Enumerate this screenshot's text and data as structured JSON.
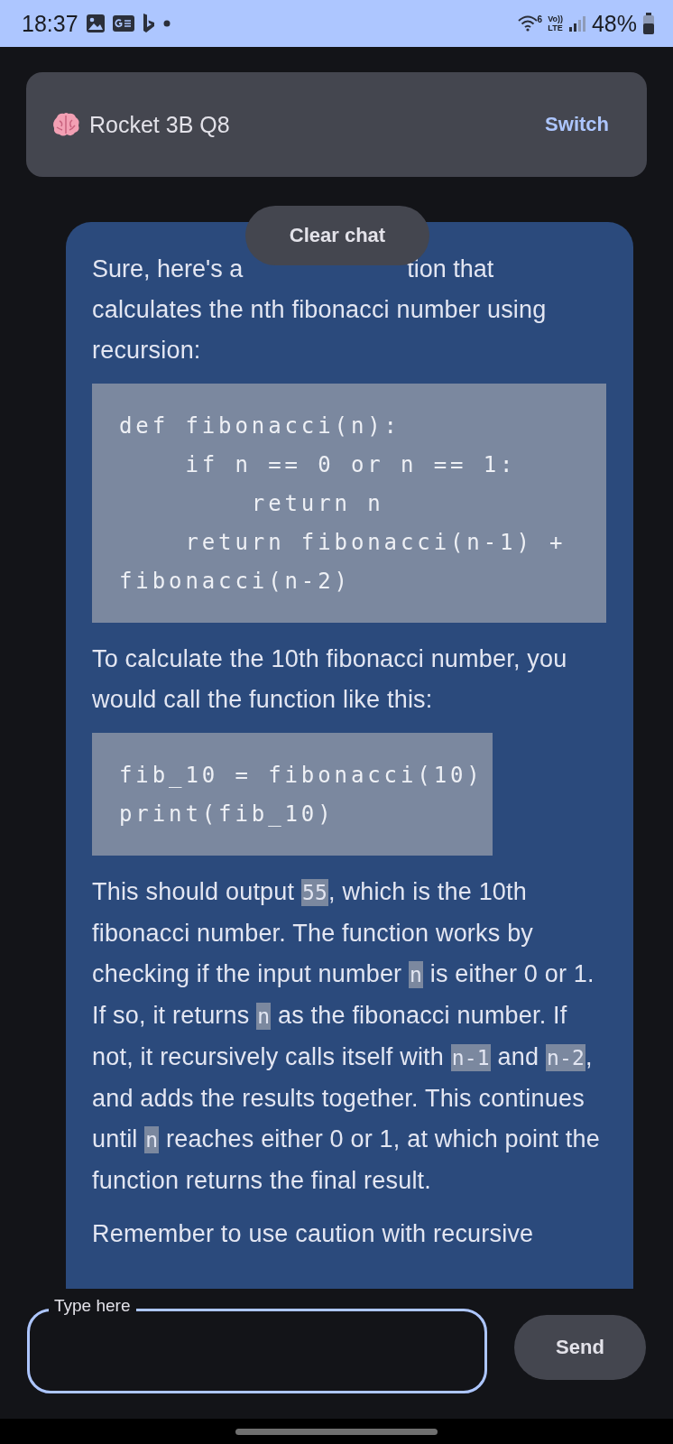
{
  "status_bar": {
    "time": "18:37",
    "wifi_label": "6",
    "network_labels": [
      "Vo))",
      "LTE"
    ],
    "battery_text": "48%"
  },
  "model_bar": {
    "name": "Rocket 3B Q8",
    "action": "Switch"
  },
  "clear_button": "Clear chat",
  "message": {
    "blocks": [
      {
        "kind": "covered",
        "parts": [
          "Sure, here's a",
          "tion that"
        ]
      },
      {
        "kind": "text",
        "parts": [
          {
            "kind": "plain",
            "text": "calculates the nth fibonacci number using recursion:"
          }
        ]
      },
      {
        "kind": "code",
        "text": "def fibonacci(n):\n    if n == 0 or n == 1:\n        return n\n    return fibonacci(n-1) + fibonacci(n-2)"
      },
      {
        "kind": "text",
        "parts": [
          {
            "kind": "plain",
            "text": "To calculate the 10th fibonacci number, you would call the function like this:"
          }
        ]
      },
      {
        "kind": "code",
        "text": "fib_10 = fibonacci(10)\nprint(fib_10)"
      },
      {
        "kind": "text",
        "parts": [
          {
            "kind": "plain",
            "text": "This should output "
          },
          {
            "kind": "code",
            "text": "55"
          },
          {
            "kind": "plain",
            "text": ", which is the 10th fibonacci number. The function works by checking if the input number "
          },
          {
            "kind": "code",
            "text": "n"
          },
          {
            "kind": "plain",
            "text": " is either 0 or 1. If so, it returns "
          },
          {
            "kind": "code",
            "text": "n"
          },
          {
            "kind": "plain",
            "text": " as the fibonacci number. If not, it recursively calls itself with "
          },
          {
            "kind": "code",
            "text": "n-1"
          },
          {
            "kind": "plain",
            "text": " and "
          },
          {
            "kind": "code",
            "text": "n-2"
          },
          {
            "kind": "plain",
            "text": ", and adds the results together. This continues until "
          },
          {
            "kind": "code",
            "text": "n"
          },
          {
            "kind": "plain",
            "text": " reaches either 0 or 1, at which point the function returns the final result."
          }
        ]
      },
      {
        "kind": "text",
        "parts": [
          {
            "kind": "plain",
            "text": "Remember to use caution with recursive"
          }
        ]
      }
    ]
  },
  "input": {
    "label": "Type here"
  },
  "send_button": "Send"
}
